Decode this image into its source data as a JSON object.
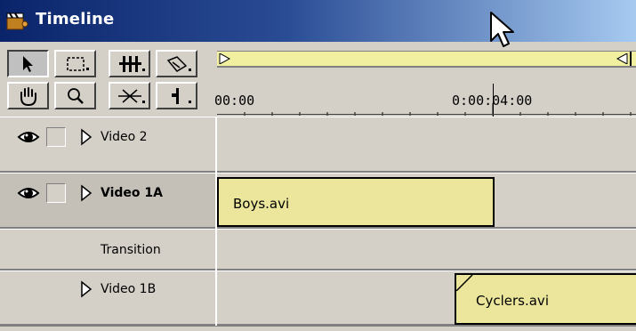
{
  "window": {
    "title": "Timeline"
  },
  "tools": [
    {
      "name": "selection-tool",
      "icon": "arrow-icon",
      "active": true
    },
    {
      "name": "range-select-tool",
      "icon": "marquee-icon",
      "active": false
    },
    {
      "name": "rolling-edit-tool",
      "icon": "rolling-edit-icon",
      "active": false
    },
    {
      "name": "razor-tool",
      "icon": "razor-icon",
      "active": false
    },
    {
      "name": "hand-tool",
      "icon": "hand-icon",
      "active": false
    },
    {
      "name": "zoom-tool",
      "icon": "zoom-icon",
      "active": false
    },
    {
      "name": "cross-fade-tool",
      "icon": "cross-fade-icon",
      "active": false
    },
    {
      "name": "in-point-tool",
      "icon": "in-point-icon",
      "active": false
    }
  ],
  "ruler": {
    "start_label": "00:00",
    "mid_label": "0:00:04:00"
  },
  "tracks": [
    {
      "id": "video-2",
      "label": "Video 2",
      "bold": false,
      "has_eye": true,
      "has_lock": true,
      "has_expand": true
    },
    {
      "id": "video-1a",
      "label": "Video 1A",
      "bold": true,
      "has_eye": true,
      "has_lock": true,
      "has_expand": true,
      "selected": true
    },
    {
      "id": "transition",
      "label": "Transition",
      "bold": false,
      "has_eye": false,
      "has_lock": false,
      "has_expand": false
    },
    {
      "id": "video-1b",
      "label": "Video 1B",
      "bold": false,
      "has_eye": false,
      "has_lock": false,
      "has_expand": true
    }
  ],
  "clips": [
    {
      "track": "video-1a",
      "name": "Boys.avi"
    },
    {
      "track": "video-1b",
      "name": "Cyclers.avi"
    }
  ],
  "colors": {
    "titlebar_start": "#0a246a",
    "titlebar_end": "#a6caf0",
    "panel": "#d4d0c8",
    "clip_fill": "#ebe69b",
    "workbar": "#f0f0a0"
  }
}
